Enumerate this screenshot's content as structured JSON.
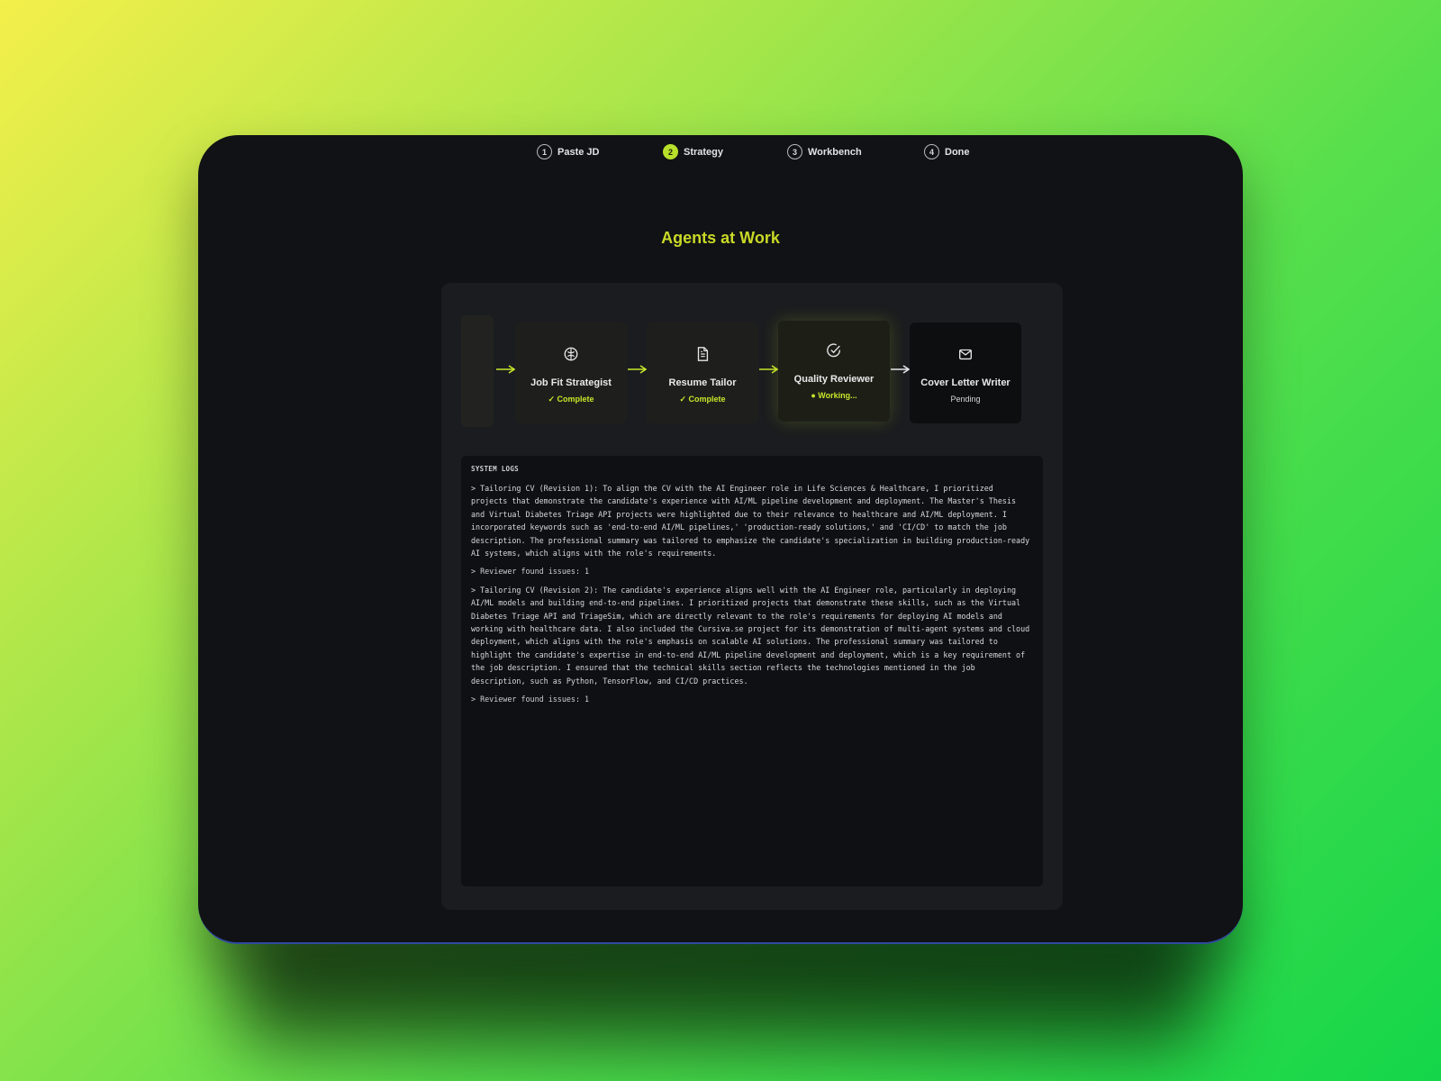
{
  "stepper": {
    "steps": [
      {
        "number": "1",
        "label": "Paste JD",
        "state": "done"
      },
      {
        "number": "2",
        "label": "Strategy",
        "state": "active"
      },
      {
        "number": "3",
        "label": "Workbench",
        "state": "upcoming"
      },
      {
        "number": "4",
        "label": "Done",
        "state": "upcoming"
      }
    ]
  },
  "header": {
    "title": "Agents at Work"
  },
  "pipeline": {
    "agents": [
      {
        "name": "Job Fit Strategist",
        "status": "✓ Complete",
        "icon": "brain-icon"
      },
      {
        "name": "Resume Tailor",
        "status": "✓ Complete",
        "icon": "document-icon"
      },
      {
        "name": "Quality Reviewer",
        "status": "● Working...",
        "icon": "check-circle-icon"
      },
      {
        "name": "Cover Letter Writer",
        "status": "Pending",
        "icon": "mail-icon"
      }
    ]
  },
  "logs": {
    "title": "SYSTEM LOGS",
    "entries": [
      ">  Tailoring CV (Revision 1): To align the CV with the AI Engineer role in Life Sciences & Healthcare, I prioritized projects that demonstrate the candidate's experience with AI/ML pipeline development and deployment. The Master's Thesis and Virtual Diabetes Triage API projects were highlighted due to their relevance to healthcare and AI/ML deployment. I incorporated keywords such as 'end-to-end AI/ML pipelines,' 'production-ready solutions,' and 'CI/CD' to match the job description. The professional summary was tailored to emphasize the candidate's specialization in building production-ready AI systems, which aligns with the role's requirements.",
      ">  Reviewer found issues: 1",
      ">  Tailoring CV (Revision 2): The candidate's experience aligns well with the AI Engineer role, particularly in deploying AI/ML models and building end-to-end pipelines. I prioritized projects that demonstrate these skills, such as the Virtual Diabetes Triage API and TriageSim, which are directly relevant to the role's requirements for deploying AI models and working with healthcare data. I also included the Cursiva.se project for its demonstration of multi-agent systems and cloud deployment, which aligns with the role's emphasis on scalable AI solutions. The professional summary was tailored to highlight the candidate's expertise in end-to-end AI/ML pipeline development and deployment, which is a key requirement of the job description. I ensured that the technical skills section reflects the technologies mentioned in the job description, such as Python, TensorFlow, and CI/CD practices.",
      ">  Reviewer found issues: 1"
    ]
  },
  "colors": {
    "accent": "#c9d926",
    "window": "#111215",
    "panel": "#1b1c1f"
  }
}
